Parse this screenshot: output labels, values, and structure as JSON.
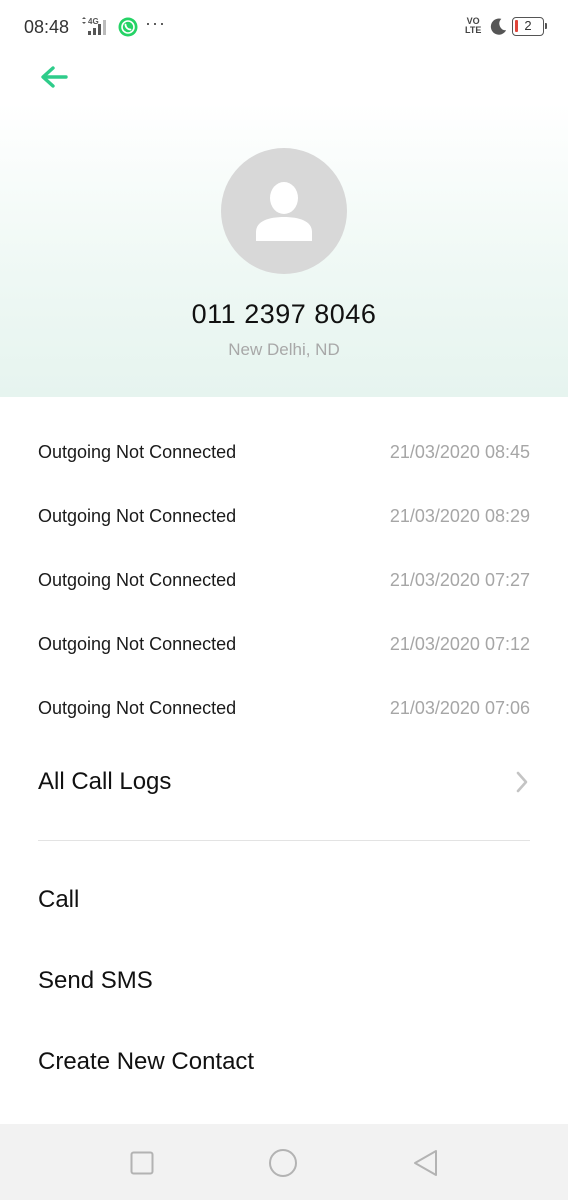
{
  "status_bar": {
    "time": "08:48",
    "network_label": "4G",
    "volte_top": "VO",
    "volte_bottom": "LTE",
    "battery_level": "2",
    "more_indicator": "···"
  },
  "contact": {
    "number": "011 2397 8046",
    "location": "New Delhi, ND"
  },
  "call_logs": [
    {
      "type": "Outgoing Not Connected",
      "datetime": "21/03/2020 08:45"
    },
    {
      "type": "Outgoing Not Connected",
      "datetime": "21/03/2020 08:29"
    },
    {
      "type": "Outgoing Not Connected",
      "datetime": "21/03/2020 07:27"
    },
    {
      "type": "Outgoing Not Connected",
      "datetime": "21/03/2020 07:12"
    },
    {
      "type": "Outgoing Not Connected",
      "datetime": "21/03/2020 07:06"
    }
  ],
  "all_call_logs_label": "All Call Logs",
  "actions": {
    "call": "Call",
    "send_sms": "Send SMS",
    "create_contact": "Create New Contact"
  },
  "colors": {
    "accent": "#2ecc8a",
    "whatsapp": "#25d366",
    "battery_low": "#e0453a"
  },
  "icons": {
    "back": "back-arrow-icon",
    "avatar": "person-icon",
    "chevron": "chevron-right-icon",
    "nav_recents": "square-icon",
    "nav_home": "circle-icon",
    "nav_back": "triangle-back-icon"
  }
}
